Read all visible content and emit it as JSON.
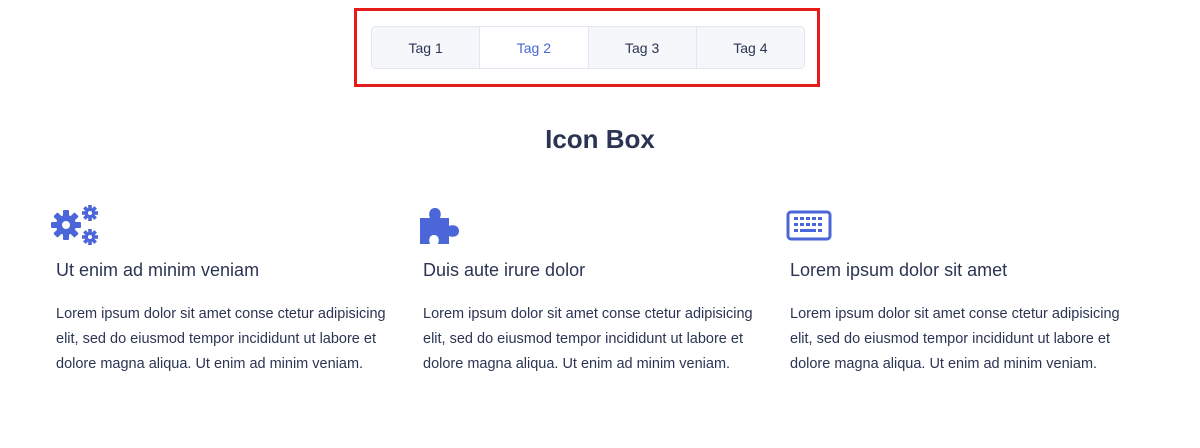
{
  "tabs": [
    {
      "label": "Tag 1",
      "active": false
    },
    {
      "label": "Tag 2",
      "active": true
    },
    {
      "label": "Tag 3",
      "active": false
    },
    {
      "label": "Tag 4",
      "active": false
    }
  ],
  "section": {
    "title": "Icon Box"
  },
  "colors": {
    "accent": "#4a66d8",
    "text": "#2b3553",
    "highlight": "#e51b1b"
  },
  "boxes": [
    {
      "icon": "gears-icon",
      "title": "Ut enim ad minim veniam",
      "text": "Lorem ipsum dolor sit amet conse ctetur adipisicing elit, sed do eiusmod tempor incididunt ut labore et dolore magna aliqua. Ut enim ad minim veniam."
    },
    {
      "icon": "puzzle-piece-icon",
      "title": "Duis aute irure dolor",
      "text": "Lorem ipsum dolor sit amet conse ctetur adipisicing elit, sed do eiusmod tempor incididunt ut labore et dolore magna aliqua. Ut enim ad minim veniam."
    },
    {
      "icon": "keyboard-icon",
      "title": "Lorem ipsum dolor sit amet",
      "text": "Lorem ipsum dolor sit amet conse ctetur adipisicing elit, sed do eiusmod tempor incididunt ut labore et dolore magna aliqua. Ut enim ad minim veniam."
    }
  ]
}
